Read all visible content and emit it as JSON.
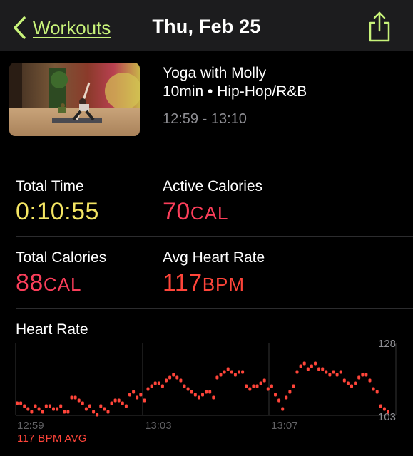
{
  "nav": {
    "back_label": "Workouts",
    "title": "Thu, Feb 25"
  },
  "workout": {
    "title": "Yoga with Molly",
    "subtitle": "10min • Hip-Hop/R&B",
    "time_range": "12:59 - 13:10"
  },
  "metrics": {
    "total_time": {
      "label": "Total Time",
      "value": "0:10:55"
    },
    "active_calories": {
      "label": "Active Calories",
      "value": "70",
      "unit": "CAL"
    },
    "total_calories": {
      "label": "Total Calories",
      "value": "88",
      "unit": "CAL"
    },
    "avg_heart_rate": {
      "label": "Avg Heart Rate",
      "value": "117",
      "unit": "BPM"
    }
  },
  "heart_rate": {
    "title": "Heart Rate",
    "avg_label": "117 BPM AVG",
    "color": "#ff453a"
  },
  "chart_data": {
    "type": "scatter",
    "x_ticks": [
      "12:59",
      "13:03",
      "13:07"
    ],
    "y_ticks": [
      "128",
      "103"
    ],
    "ylim": [
      103,
      128
    ],
    "values": [
      107,
      107,
      106,
      105,
      104,
      106,
      105,
      104,
      106,
      106,
      105,
      105,
      106,
      104,
      104,
      109,
      109,
      108,
      107,
      105,
      106,
      104,
      103,
      106,
      105,
      104,
      107,
      108,
      108,
      107,
      106,
      110,
      111,
      109,
      110,
      108,
      112,
      113,
      114,
      114,
      113,
      115,
      116,
      117,
      116,
      115,
      113,
      112,
      111,
      110,
      109,
      110,
      111,
      111,
      109,
      116,
      117,
      118,
      119,
      118,
      117,
      118,
      118,
      113,
      112,
      113,
      113,
      114,
      115,
      112,
      113,
      110,
      108,
      105,
      109,
      111,
      113,
      118,
      120,
      121,
      119,
      120,
      121,
      119,
      119,
      118,
      117,
      118,
      117,
      118,
      115,
      114,
      113,
      114,
      116,
      117,
      117,
      115,
      112,
      111,
      106,
      105,
      104
    ]
  }
}
